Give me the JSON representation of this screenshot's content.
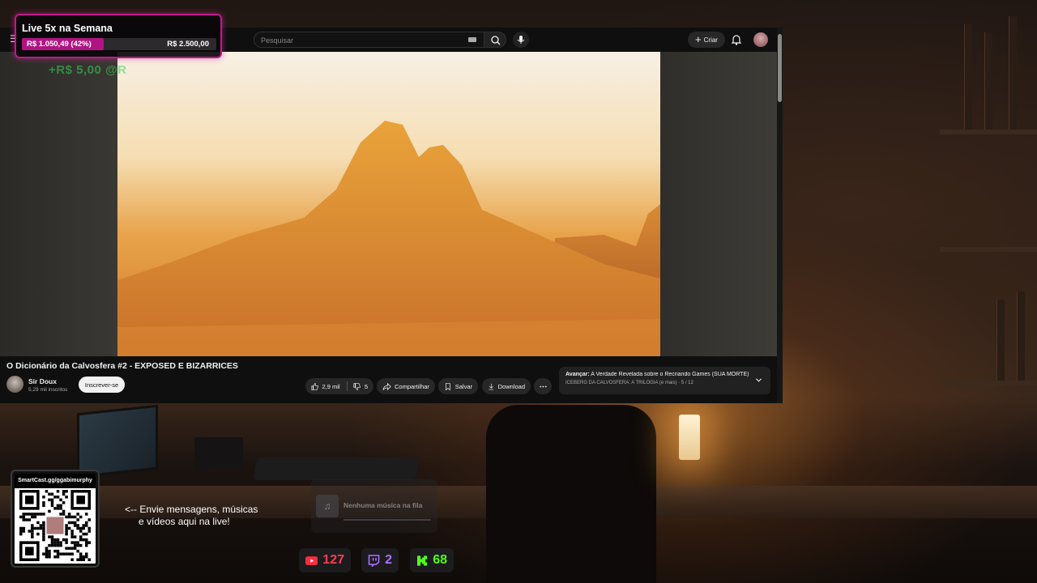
{
  "goal": {
    "title": "Live 5x na Semana",
    "current": "R$ 1.050,49 (42%)",
    "target": "R$ 2.500,00",
    "progress_fraction": 0.42,
    "accent": "#c2178d"
  },
  "donation_ghost": "+R$ 5,00 @R",
  "youtube": {
    "search_placeholder": "Pesquisar",
    "create_label": "Criar",
    "video_title": "O Dicionário da Calvosfera #2 - EXPOSED E BIZARRICES",
    "channel_name": "Sir Doux",
    "channel_subs": "5,29 mil inscritos",
    "subscribe_label": "Inscrever-se",
    "likes": "2,9 mil",
    "dislikes": "5",
    "share_label": "Compartilhar",
    "save_label": "Salvar",
    "download_label": "Download",
    "playlist_next_prefix": "Avançar:",
    "playlist_next_title": "A Verdade Revelada sobre o Recriando Games (SUA MORTE)",
    "playlist_sub": "ICEBERG DA CALVOSFERA: A TRILOGIA (e mais) · 5 / 12"
  },
  "qr": {
    "header": "SmartCast.gg/ggabimurphy"
  },
  "cta": {
    "line1": "<-- Envie mensagens, músicas",
    "line2": "e vídeos aqui na live!"
  },
  "music": {
    "empty_text": "Nenhuma música na fila"
  },
  "viewers": {
    "youtube": "127",
    "twitch": "2",
    "kick": "68",
    "youtube_color": "#ff3b4e",
    "twitch_color": "#a970ff",
    "kick_color": "#53fc18"
  }
}
